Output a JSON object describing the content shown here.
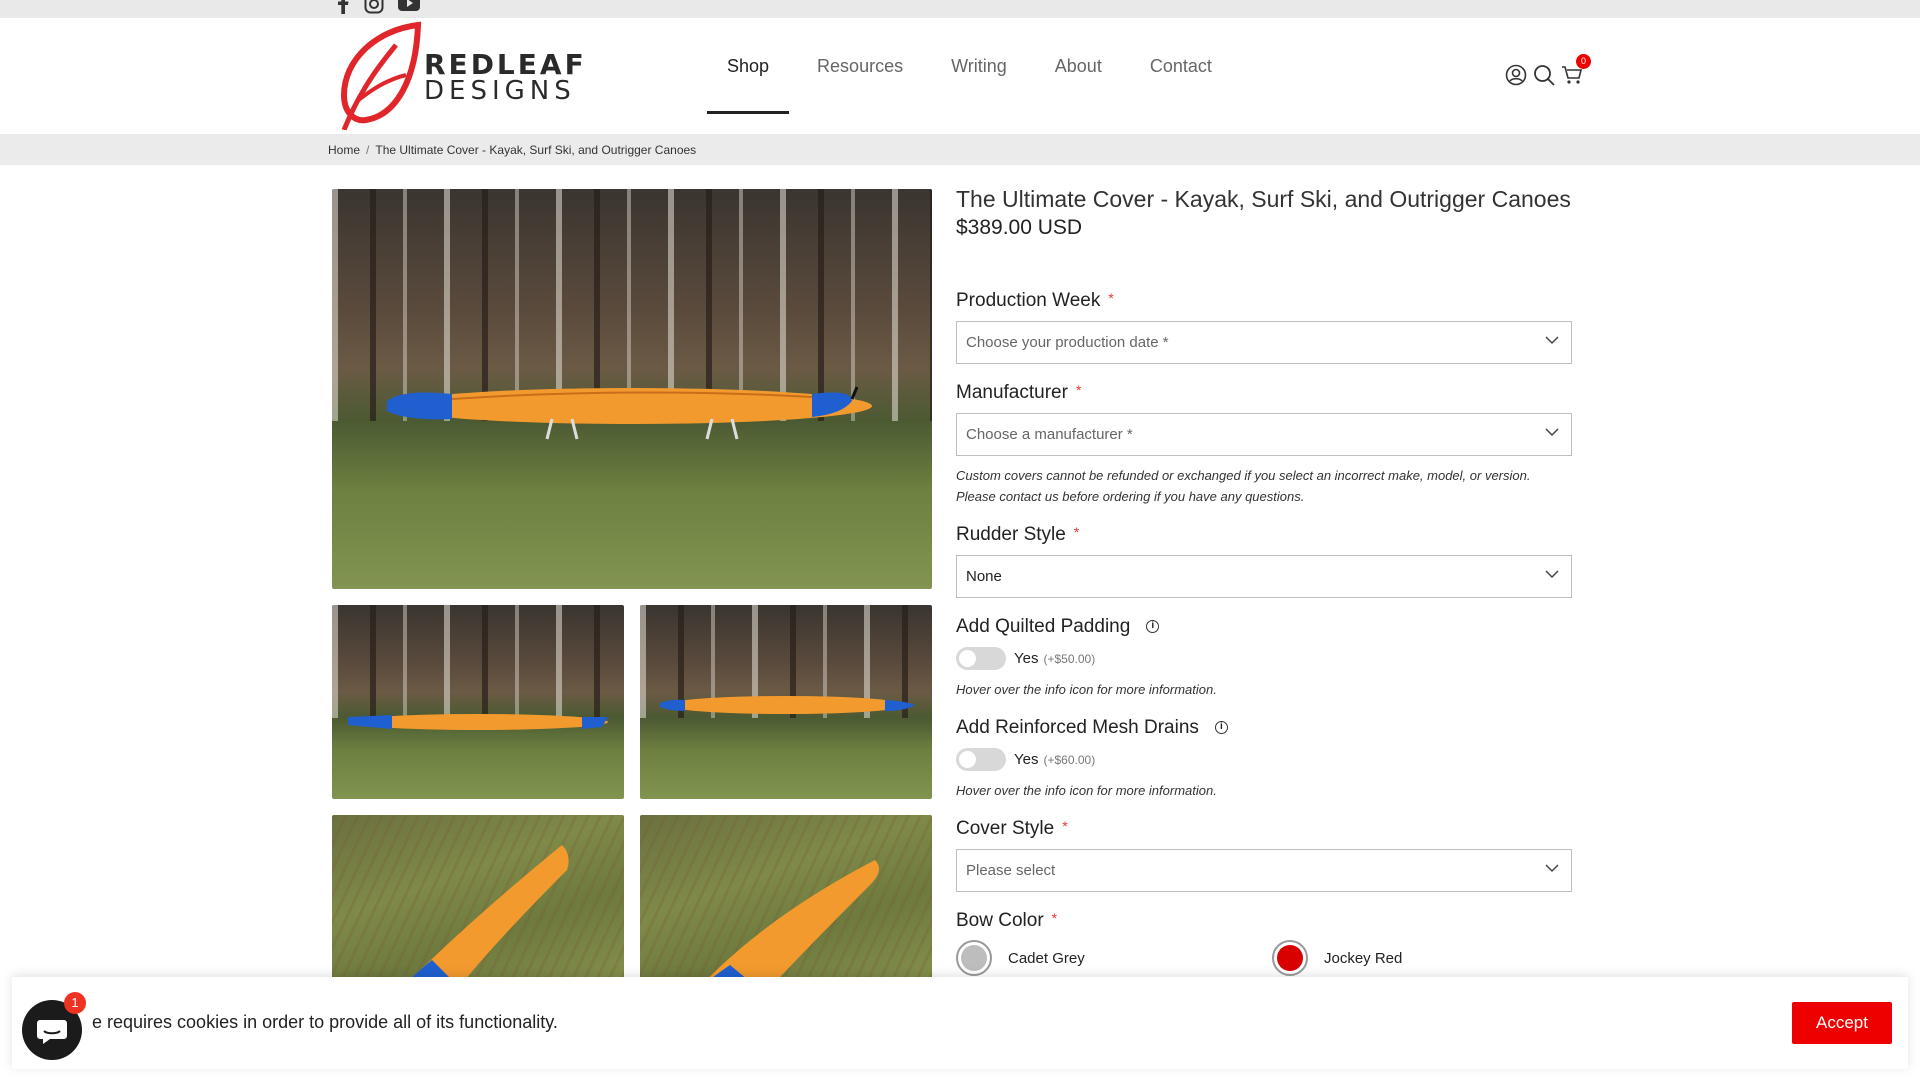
{
  "social": [
    "facebook-icon",
    "instagram-icon",
    "youtube-icon"
  ],
  "brand": {
    "line1": "REDLEAF",
    "line2": "DESIGNS"
  },
  "nav": [
    {
      "label": "Shop",
      "active": true
    },
    {
      "label": "Resources",
      "active": false
    },
    {
      "label": "Writing",
      "active": false
    },
    {
      "label": "About",
      "active": false
    },
    {
      "label": "Contact",
      "active": false
    }
  ],
  "header_icons": {
    "account": "account-icon",
    "search": "search-icon",
    "cart": "cart-icon",
    "cart_count": "0"
  },
  "breadcrumb": {
    "home": "Home",
    "separator": "/",
    "current": "The Ultimate Cover - Kayak, Surf Ski, and Outrigger Canoes"
  },
  "product": {
    "title": "The Ultimate Cover - Kayak, Surf Ski, and Outrigger Canoes",
    "price": "$389.00 USD"
  },
  "options": {
    "production_week": {
      "label": "Production Week",
      "required": "*",
      "placeholder": "Choose your production date *"
    },
    "manufacturer": {
      "label": "Manufacturer",
      "required": "*",
      "placeholder": "Choose a manufacturer *"
    },
    "manufacturer_note": "Custom covers cannot be refunded or exchanged if you select an incorrect make, model, or version. Please contact us before ordering if you have any questions.",
    "rudder_style": {
      "label": "Rudder Style",
      "required": "*",
      "value": "None"
    },
    "quilted_padding": {
      "label": "Add Quilted Padding",
      "toggle_label": "Yes",
      "price": "(+$50.00)",
      "note": "Hover over the info icon for more information.",
      "enabled": false
    },
    "mesh_drains": {
      "label": "Add Reinforced Mesh Drains",
      "toggle_label": "Yes",
      "price": "(+$60.00)",
      "note": "Hover over the info icon for more information.",
      "enabled": false
    },
    "cover_style": {
      "label": "Cover Style",
      "required": "*",
      "placeholder": "Please select"
    },
    "bow_color": {
      "label": "Bow Color",
      "required": "*",
      "swatches": [
        {
          "name": "Cadet Grey",
          "color": "#bdbdbd"
        },
        {
          "name": "Jockey Red",
          "color": "#d90000"
        }
      ]
    }
  },
  "cookie": {
    "text": "e requires cookies in order to provide all of its functionality.",
    "accept": "Accept"
  },
  "chat": {
    "badge": "1"
  },
  "colors": {
    "accent": "#e00000",
    "kayak_orange": "#f39a2e",
    "kayak_blue": "#1f5fd0"
  }
}
